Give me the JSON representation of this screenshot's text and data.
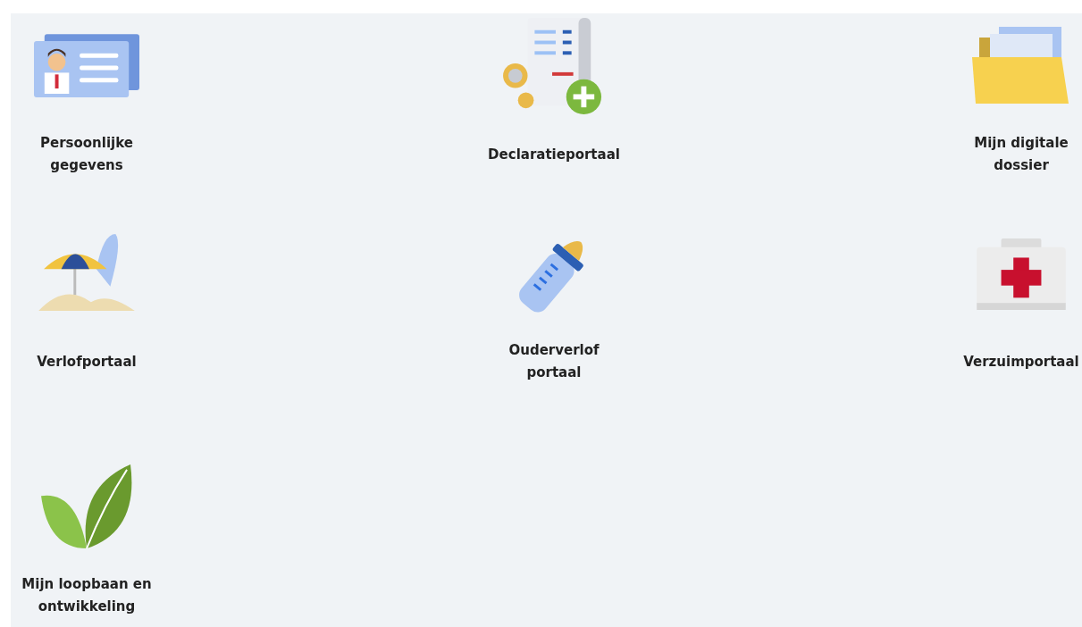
{
  "tiles": [
    {
      "kind": "id-card",
      "label": "Persoonlijke gegevens"
    },
    {
      "kind": "receipt",
      "label": "Declaratieportaal"
    },
    {
      "kind": "folder",
      "label": "Mijn digitale dossier"
    },
    {
      "kind": "beach",
      "label": "Verlofportaal"
    },
    {
      "kind": "bottle",
      "label": "Ouderverlof portaal"
    },
    {
      "kind": "first-aid",
      "label": "Verzuimportaal"
    },
    {
      "kind": "leaves",
      "label": "Mijn loopbaan en ontwikkeling"
    }
  ]
}
